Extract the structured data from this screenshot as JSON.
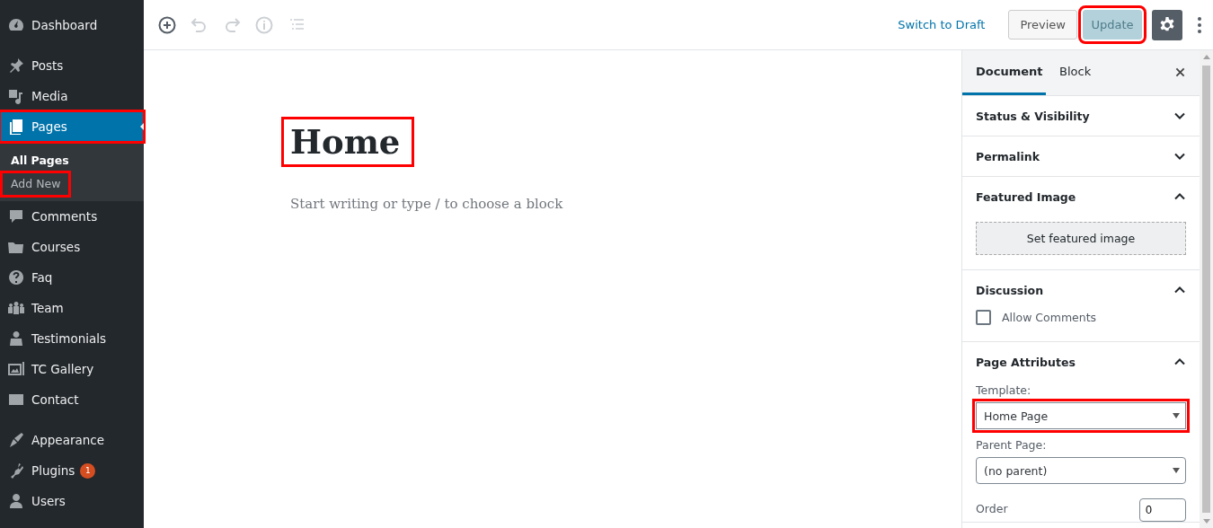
{
  "admin_menu": {
    "groups": [
      [
        {
          "label": "Dashboard",
          "selected": false,
          "highlighted": false
        }
      ],
      [
        {
          "label": "Posts",
          "selected": false,
          "highlighted": false
        },
        {
          "label": "Media",
          "selected": false,
          "highlighted": false
        },
        {
          "label": "Pages",
          "selected": true,
          "highlighted": true,
          "submenu": [
            {
              "label": "All Pages",
              "selected": true,
              "highlighted": false
            },
            {
              "label": "Add New",
              "selected": false,
              "highlighted": true
            }
          ]
        },
        {
          "label": "Comments",
          "selected": false,
          "highlighted": false
        },
        {
          "label": "Courses",
          "selected": false,
          "highlighted": false
        },
        {
          "label": "Faq",
          "selected": false,
          "highlighted": false
        },
        {
          "label": "Team",
          "selected": false,
          "highlighted": false
        },
        {
          "label": "Testimonials",
          "selected": false,
          "highlighted": false
        },
        {
          "label": "TC Gallery",
          "selected": false,
          "highlighted": false
        },
        {
          "label": "Contact",
          "selected": false,
          "highlighted": false
        }
      ],
      [
        {
          "label": "Appearance",
          "selected": false,
          "highlighted": false
        },
        {
          "label": "Plugins",
          "selected": false,
          "highlighted": false,
          "badge": "1"
        },
        {
          "label": "Users",
          "selected": false,
          "highlighted": false
        }
      ]
    ]
  },
  "toolbar": {
    "tools": [
      {
        "disabled": false
      },
      {
        "disabled": true
      },
      {
        "disabled": true
      },
      {
        "disabled": true
      },
      {
        "disabled": true
      }
    ],
    "switch_to_draft": "Switch to Draft",
    "preview": "Preview",
    "update": {
      "label": "Update",
      "disabled": true,
      "highlighted": true
    },
    "settings": {
      "selected": true
    }
  },
  "editor": {
    "title": {
      "text": "Home",
      "highlighted": true
    },
    "placeholder": "Start writing or type / to choose a block"
  },
  "settings_sidebar": {
    "tabs": [
      {
        "label": "Document",
        "selected": true
      },
      {
        "label": "Block",
        "selected": false
      }
    ],
    "panels": [
      {
        "title": "Status & Visibility",
        "expanded": false
      },
      {
        "title": "Permalink",
        "expanded": false
      },
      {
        "kind": "featured_image",
        "title": "Featured Image",
        "expanded": true,
        "button": "Set featured image"
      },
      {
        "kind": "discussion",
        "title": "Discussion",
        "expanded": true,
        "checkbox": {
          "label": "Allow Comments",
          "checked": false
        }
      },
      {
        "kind": "attributes",
        "title": "Page Attributes",
        "expanded": true,
        "template": {
          "label": "Template:",
          "value": "Home Page",
          "highlighted": true
        },
        "parent": {
          "label": "Parent Page:",
          "value": "(no parent)",
          "highlighted": false
        },
        "order": {
          "label": "Order",
          "value": "0"
        }
      }
    ]
  }
}
